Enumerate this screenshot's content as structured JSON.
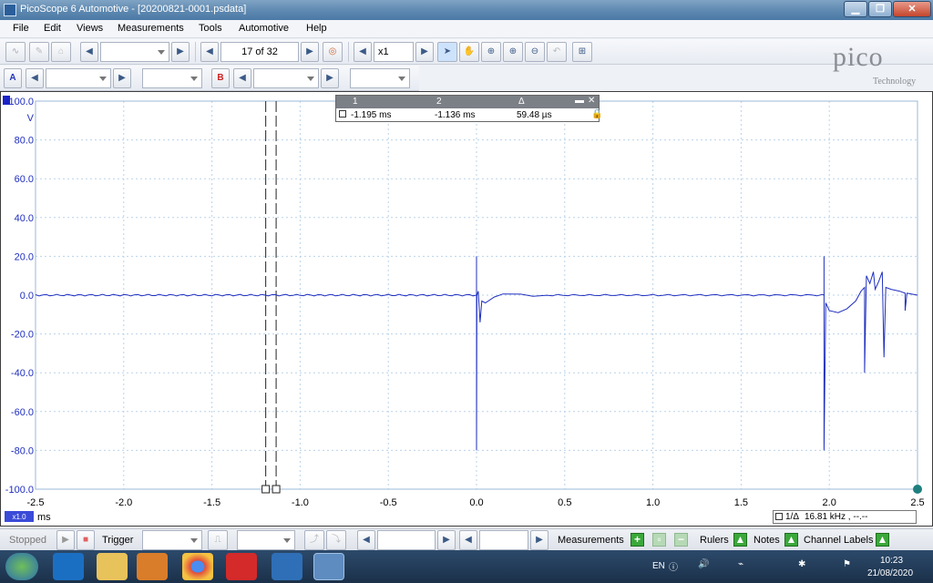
{
  "window": {
    "title": "PicoScope 6 Automotive - [20200821-0001.psdata]"
  },
  "menu": [
    "File",
    "Edit",
    "Views",
    "Measurements",
    "Tools",
    "Automotive",
    "Help"
  ],
  "toolbar": {
    "buffer_position": "17 of 32",
    "zoom": "x1"
  },
  "channels": {
    "a_label": "A",
    "b_label": "B"
  },
  "logo": {
    "word": "pico",
    "subtitle": "Technology"
  },
  "scope": {
    "y_top_label": "100.0",
    "y_unit": "V",
    "x_unit": "ms",
    "x_scale_badge": "x1.0",
    "y_ticks": [
      "100.0",
      "80.0",
      "60.0",
      "40.0",
      "20.0",
      "0.0",
      "-20.0",
      "-40.0",
      "-60.0",
      "-80.0",
      "-100.0"
    ],
    "x_ticks": [
      "-2.5",
      "-2.0",
      "-1.5",
      "-1.0",
      "-0.5",
      "0.0",
      "0.5",
      "1.0",
      "1.5",
      "2.0",
      "2.5"
    ]
  },
  "rulers": {
    "col1_header": "1",
    "col2_header": "2",
    "col3_header": "Δ",
    "col1_value": "-1.195 ms",
    "col2_value": "-1.136 ms",
    "col3_value": "59.48 µs"
  },
  "freq": {
    "label": "1/Δ",
    "value": "16.81 kHz , --.--"
  },
  "status": {
    "stopped": "Stopped",
    "trigger": "Trigger",
    "measurements": "Measurements",
    "rulers": "Rulers",
    "notes": "Notes",
    "channel_labels": "Channel Labels"
  },
  "tray": {
    "lang": "EN",
    "time": "10:23",
    "date": "21/08/2020"
  },
  "colors": {
    "trace": "#1f2fbf",
    "axis_text": "#1f2fbf",
    "grid": "#b9d3ea"
  }
}
